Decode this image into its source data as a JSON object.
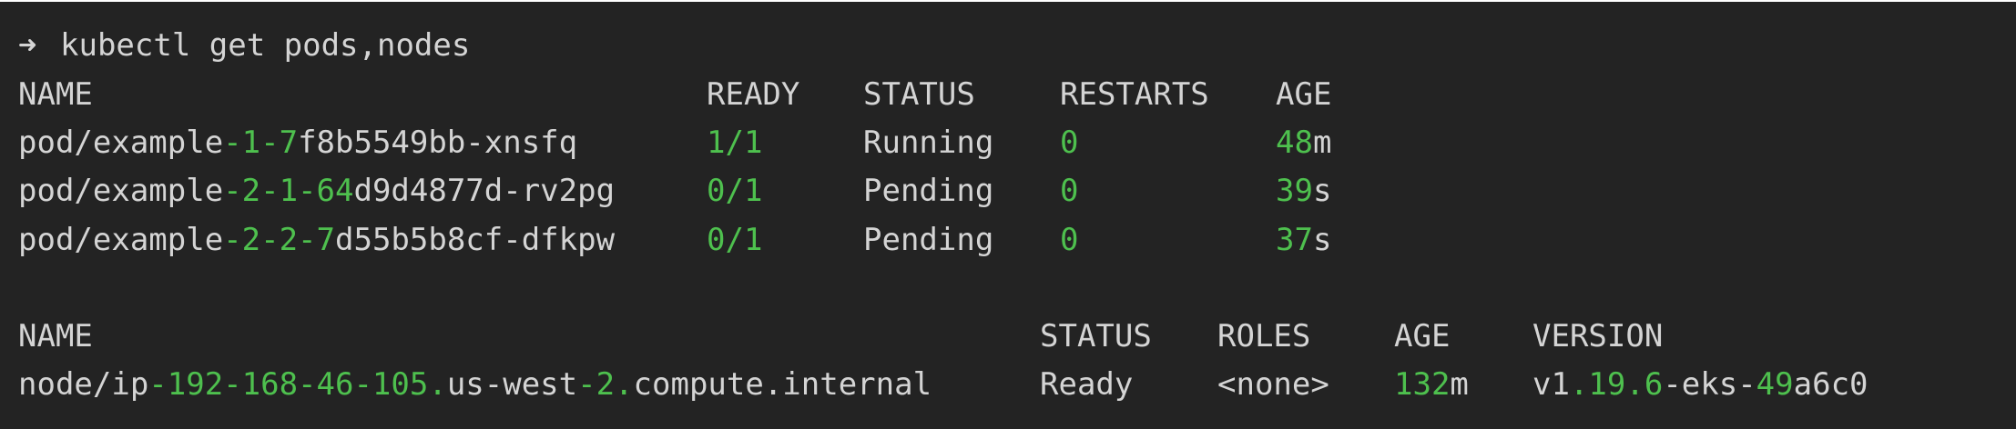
{
  "terminal": {
    "prompt": "➜",
    "command": "kubectl get pods,nodes",
    "accent_color": "#4ec04e",
    "text_color": "#d4d4d4",
    "background_color": "#232323"
  },
  "pods": {
    "headers": [
      "NAME",
      "READY",
      "STATUS",
      "RESTARTS",
      "AGE"
    ],
    "rows": [
      {
        "name": [
          [
            "pod/example",
            "n"
          ],
          [
            "-1-7",
            "g"
          ],
          [
            "f8b5549bb-xnsfq",
            "n"
          ]
        ],
        "ready": "1/1",
        "ready_color": "g",
        "status": "Running",
        "restarts": "0",
        "age": [
          [
            "48",
            "g"
          ],
          [
            "m",
            "n"
          ]
        ]
      },
      {
        "name": [
          [
            "pod/example",
            "n"
          ],
          [
            "-2-1-64",
            "g"
          ],
          [
            "d9d4877d-rv2pg",
            "n"
          ]
        ],
        "ready": "0/1",
        "ready_color": "g",
        "status": "Pending",
        "restarts": "0",
        "age": [
          [
            "39",
            "g"
          ],
          [
            "s",
            "n"
          ]
        ]
      },
      {
        "name": [
          [
            "pod/example",
            "n"
          ],
          [
            "-2-2-7",
            "g"
          ],
          [
            "d55b5b8cf-dfkpw",
            "n"
          ]
        ],
        "ready": "0/1",
        "ready_color": "g",
        "status": "Pending",
        "restarts": "0",
        "age": [
          [
            "37",
            "g"
          ],
          [
            "s",
            "n"
          ]
        ]
      }
    ]
  },
  "nodes": {
    "headers": [
      "NAME",
      "STATUS",
      "ROLES",
      "AGE",
      "VERSION"
    ],
    "rows": [
      {
        "name": [
          [
            "node/ip",
            "n"
          ],
          [
            "-192-168-46-105.",
            "g"
          ],
          [
            "us-west",
            "n"
          ],
          [
            "-2.",
            "g"
          ],
          [
            "compute.internal",
            "n"
          ]
        ],
        "status": "Ready",
        "roles": "<none>",
        "age": [
          [
            "132",
            "g"
          ],
          [
            "m",
            "n"
          ]
        ],
        "version": [
          [
            "v1",
            "n"
          ],
          [
            ".19.6",
            "g"
          ],
          [
            "-eks-",
            "n"
          ],
          [
            "49",
            "g"
          ],
          [
            "a6c0",
            "n"
          ]
        ]
      }
    ]
  }
}
